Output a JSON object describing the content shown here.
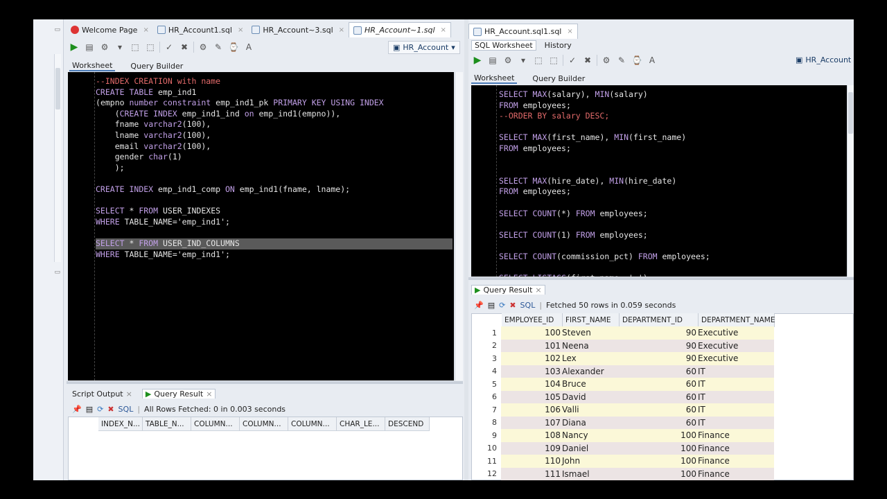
{
  "left_tabs": [
    {
      "label": "Welcome Page",
      "icon": "oracle-icon"
    },
    {
      "label": "HR_Account1.sql",
      "icon": "sql-file-icon"
    },
    {
      "label": "HR_Account~3.sql",
      "icon": "sql-file-icon"
    },
    {
      "label": "HR_Account~1.sql",
      "icon": "sql-file-icon",
      "active": true
    }
  ],
  "right_tabs": [
    {
      "label": "HR_Account.sql1.sql",
      "icon": "sql-file-icon",
      "active": true
    }
  ],
  "right_subheader": {
    "worksheet": "SQL Worksheet",
    "history": "History"
  },
  "connection": {
    "left": "HR_Account",
    "right": "HR_Account"
  },
  "left_worksheet_tabs": {
    "worksheet": "Worksheet",
    "query_builder": "Query Builder"
  },
  "right_worksheet_tabs": {
    "worksheet": "Worksheet",
    "query_builder": "Query Builder"
  },
  "left_editor_lines": [
    "--INDEX CREATION with name",
    "CREATE TABLE emp_ind1",
    "(empno number constraint emp_ind1_pk PRIMARY KEY USING INDEX",
    "    (CREATE INDEX emp_ind1_ind on emp_ind1(empno)),",
    "    fname varchar2(100),",
    "    lname varchar2(100),",
    "    email varchar2(100),",
    "    gender char(1)",
    "    );",
    "",
    "CREATE INDEX emp_ind1_comp ON emp_ind1(fname, lname);",
    "",
    "SELECT * FROM USER_INDEXES",
    "WHERE TABLE_NAME='emp_ind1';",
    "",
    "SELECT * FROM USER_IND_COLUMNS",
    "WHERE TABLE_NAME='emp_ind1';"
  ],
  "right_editor_lines": [
    "SELECT MAX(salary), MIN(salary)",
    "FROM employees;",
    "--ORDER BY salary DESC;",
    "",
    "SELECT MAX(first_name), MIN(first_name)",
    "FROM employees;",
    "",
    "",
    "SELECT MAX(hire_date), MIN(hire_date)",
    "FROM employees;",
    "",
    "SELECT COUNT(*) FROM employees;",
    "",
    "SELECT COUNT(1) FROM employees;",
    "",
    "SELECT COUNT(commission_pct) FROM employees;",
    "",
    "SELECT LISTAGG(first_name, ',')"
  ],
  "left_result": {
    "tabs": [
      "Script Output",
      "Query Result"
    ],
    "sql_label": "SQL",
    "status": "All Rows Fetched: 0 in 0.003 seconds",
    "columns": [
      "INDEX_N...",
      "TABLE_N...",
      "COLUMN...",
      "COLUMN...",
      "COLUMN...",
      "CHAR_LE...",
      "DESCEND"
    ]
  },
  "right_result": {
    "tab": "Query Result",
    "sql_label": "SQL",
    "status": "Fetched 50 rows in 0.059 seconds",
    "columns": [
      "EMPLOYEE_ID",
      "FIRST_NAME",
      "DEPARTMENT_ID",
      "DEPARTMENT_NAME"
    ],
    "rows": [
      [
        "1",
        "100",
        "Steven",
        "90",
        "Executive"
      ],
      [
        "2",
        "101",
        "Neena",
        "90",
        "Executive"
      ],
      [
        "3",
        "102",
        "Lex",
        "90",
        "Executive"
      ],
      [
        "4",
        "103",
        "Alexander",
        "60",
        "IT"
      ],
      [
        "5",
        "104",
        "Bruce",
        "60",
        "IT"
      ],
      [
        "6",
        "105",
        "David",
        "60",
        "IT"
      ],
      [
        "7",
        "106",
        "Valli",
        "60",
        "IT"
      ],
      [
        "8",
        "107",
        "Diana",
        "60",
        "IT"
      ],
      [
        "9",
        "108",
        "Nancy",
        "100",
        "Finance"
      ],
      [
        "10",
        "109",
        "Daniel",
        "100",
        "Finance"
      ],
      [
        "11",
        "110",
        "John",
        "100",
        "Finance"
      ],
      [
        "12",
        "111",
        "Ismael",
        "100",
        "Finance"
      ]
    ]
  },
  "colors": {
    "editor_bg": "#000000",
    "keyword": "#c2a0e8",
    "comment": "#e26a6a",
    "run_green": "#1d8f1d",
    "row_odd": "#fbf8d8",
    "row_even": "#ece4e4"
  }
}
